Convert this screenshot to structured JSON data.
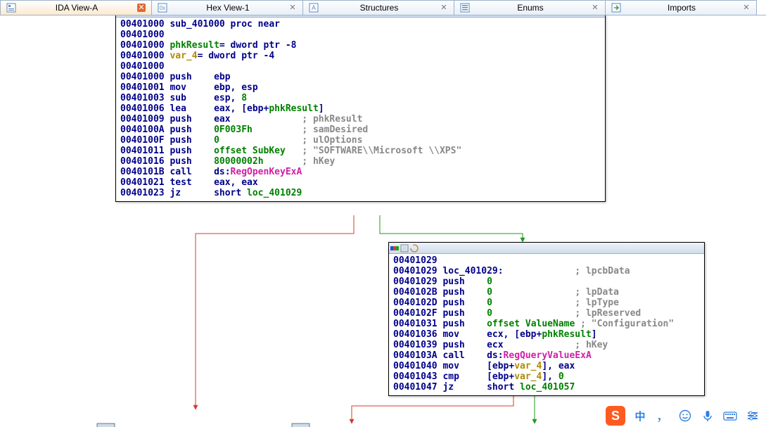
{
  "tabs": [
    {
      "label": "IDA View-A",
      "icon": "ida-icon",
      "active": true
    },
    {
      "label": "Hex View-1",
      "icon": "hex-icon",
      "active": false
    },
    {
      "label": "Structures",
      "icon": "struct-icon",
      "active": false
    },
    {
      "label": "Enums",
      "icon": "enum-icon",
      "active": false
    },
    {
      "label": "Imports",
      "icon": "imports-icon",
      "active": false
    }
  ],
  "node1": {
    "lines": [
      [
        [
          "addr",
          "00401000"
        ],
        [
          "txt",
          " "
        ],
        [
          "mn",
          "sub_401000 proc near"
        ]
      ],
      [
        [
          "addr",
          "00401000"
        ]
      ],
      [
        [
          "addr",
          "00401000"
        ],
        [
          "txt",
          " "
        ],
        [
          "id",
          "phkResult"
        ],
        [
          "mn",
          "= dword ptr -8"
        ]
      ],
      [
        [
          "addr",
          "00401000"
        ],
        [
          "txt",
          " "
        ],
        [
          "gold",
          "var_4"
        ],
        [
          "mn",
          "= dword ptr -4"
        ]
      ],
      [
        [
          "addr",
          "00401000"
        ]
      ],
      [
        [
          "addr",
          "00401000"
        ],
        [
          "txt",
          " "
        ],
        [
          "mn",
          "push    ebp"
        ]
      ],
      [
        [
          "addr",
          "00401001"
        ],
        [
          "txt",
          " "
        ],
        [
          "mn",
          "mov     ebp, esp"
        ]
      ],
      [
        [
          "addr",
          "00401003"
        ],
        [
          "txt",
          " "
        ],
        [
          "mn",
          "sub     esp, "
        ],
        [
          "num",
          "8"
        ]
      ],
      [
        [
          "addr",
          "00401006"
        ],
        [
          "txt",
          " "
        ],
        [
          "mn",
          "lea     eax, [ebp+"
        ],
        [
          "id",
          "phkResult"
        ],
        [
          "mn",
          "]"
        ]
      ],
      [
        [
          "addr",
          "00401009"
        ],
        [
          "txt",
          " "
        ],
        [
          "mn",
          "push    eax             "
        ],
        [
          "cmt",
          "; phkResult"
        ]
      ],
      [
        [
          "addr",
          "0040100A"
        ],
        [
          "txt",
          " "
        ],
        [
          "mn",
          "push    "
        ],
        [
          "num",
          "0F003Fh"
        ],
        [
          "mn",
          "         "
        ],
        [
          "cmt",
          "; samDesired"
        ]
      ],
      [
        [
          "addr",
          "0040100F"
        ],
        [
          "txt",
          " "
        ],
        [
          "mn",
          "push    "
        ],
        [
          "num",
          "0"
        ],
        [
          "mn",
          "               "
        ],
        [
          "cmt",
          "; ulOptions"
        ]
      ],
      [
        [
          "addr",
          "00401011"
        ],
        [
          "txt",
          " "
        ],
        [
          "mn",
          "push    "
        ],
        [
          "id",
          "offset SubKey"
        ],
        [
          "mn",
          "   "
        ],
        [
          "cmt",
          "; \"SOFTWARE\\\\Microsoft \\\\XPS\""
        ]
      ],
      [
        [
          "addr",
          "00401016"
        ],
        [
          "txt",
          " "
        ],
        [
          "mn",
          "push    "
        ],
        [
          "num",
          "80000002h"
        ],
        [
          "mn",
          "       "
        ],
        [
          "cmt",
          "; hKey"
        ]
      ],
      [
        [
          "addr",
          "0040101B"
        ],
        [
          "txt",
          " "
        ],
        [
          "mn",
          "call    ds:"
        ],
        [
          "call",
          "RegOpenKeyExA"
        ]
      ],
      [
        [
          "addr",
          "00401021"
        ],
        [
          "txt",
          " "
        ],
        [
          "mn",
          "test    eax, eax"
        ]
      ],
      [
        [
          "addr",
          "00401023"
        ],
        [
          "txt",
          " "
        ],
        [
          "mn",
          "jz      short "
        ],
        [
          "id",
          "loc_401029"
        ]
      ]
    ]
  },
  "node2": {
    "lines": [
      [
        [
          "addr",
          "00401029"
        ]
      ],
      [
        [
          "addr",
          "00401029"
        ],
        [
          "txt",
          " "
        ],
        [
          "mn",
          "loc_401029:             "
        ],
        [
          "cmt",
          "; lpcbData"
        ]
      ],
      [
        [
          "addr",
          "00401029"
        ],
        [
          "txt",
          " "
        ],
        [
          "mn",
          "push    "
        ],
        [
          "num",
          "0"
        ]
      ],
      [
        [
          "addr",
          "0040102B"
        ],
        [
          "txt",
          " "
        ],
        [
          "mn",
          "push    "
        ],
        [
          "num",
          "0"
        ],
        [
          "mn",
          "               "
        ],
        [
          "cmt",
          "; lpData"
        ]
      ],
      [
        [
          "addr",
          "0040102D"
        ],
        [
          "txt",
          " "
        ],
        [
          "mn",
          "push    "
        ],
        [
          "num",
          "0"
        ],
        [
          "mn",
          "               "
        ],
        [
          "cmt",
          "; lpType"
        ]
      ],
      [
        [
          "addr",
          "0040102F"
        ],
        [
          "txt",
          " "
        ],
        [
          "mn",
          "push    "
        ],
        [
          "num",
          "0"
        ],
        [
          "mn",
          "               "
        ],
        [
          "cmt",
          "; lpReserved"
        ]
      ],
      [
        [
          "addr",
          "00401031"
        ],
        [
          "txt",
          " "
        ],
        [
          "mn",
          "push    "
        ],
        [
          "id",
          "offset ValueName"
        ],
        [
          "txt",
          " "
        ],
        [
          "cmt",
          "; \"Configuration\""
        ]
      ],
      [
        [
          "addr",
          "00401036"
        ],
        [
          "txt",
          " "
        ],
        [
          "mn",
          "mov     ecx, [ebp+"
        ],
        [
          "id",
          "phkResult"
        ],
        [
          "mn",
          "]"
        ]
      ],
      [
        [
          "addr",
          "00401039"
        ],
        [
          "txt",
          " "
        ],
        [
          "mn",
          "push    ecx             "
        ],
        [
          "cmt",
          "; hKey"
        ]
      ],
      [
        [
          "addr",
          "0040103A"
        ],
        [
          "txt",
          " "
        ],
        [
          "mn",
          "call    ds:"
        ],
        [
          "call",
          "RegQueryValueExA"
        ]
      ],
      [
        [
          "addr",
          "00401040"
        ],
        [
          "txt",
          " "
        ],
        [
          "mn",
          "mov     [ebp+"
        ],
        [
          "gold",
          "var_4"
        ],
        [
          "mn",
          "], eax"
        ]
      ],
      [
        [
          "addr",
          "00401043"
        ],
        [
          "txt",
          " "
        ],
        [
          "mn",
          "cmp     [ebp+"
        ],
        [
          "gold",
          "var_4"
        ],
        [
          "mn",
          "], "
        ],
        [
          "num",
          "0"
        ]
      ],
      [
        [
          "addr",
          "00401047"
        ],
        [
          "txt",
          " "
        ],
        [
          "mn",
          "jz      short "
        ],
        [
          "id",
          "loc_401057"
        ]
      ]
    ]
  },
  "ime": {
    "sogou": "S",
    "zhong": "中",
    "comma": "，"
  }
}
